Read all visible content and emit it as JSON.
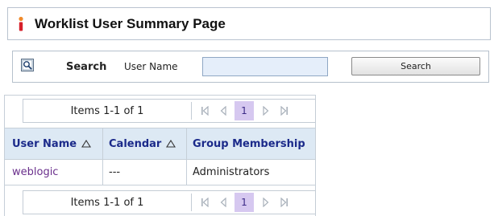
{
  "page": {
    "title": "Worklist User Summary Page",
    "title_icon": "info-icon"
  },
  "search": {
    "heading": "Search",
    "field_label": "User Name",
    "input_value": "",
    "button_label": "Search",
    "icon": "search-icon"
  },
  "pager": {
    "items_text": "Items 1-1 of 1",
    "current_page": "1",
    "icons": [
      "first-page-icon",
      "previous-page-icon",
      "next-page-icon",
      "last-page-icon"
    ]
  },
  "table": {
    "columns": [
      "User Name",
      "Calendar",
      "Group Membership"
    ],
    "rows": [
      [
        "weblogic",
        "---",
        "Administrators"
      ]
    ]
  },
  "colors": {
    "header_text": "#1b2a8a",
    "header_bg": "#dde9f4",
    "link": "#6a2f8c",
    "active_page_bg": "#d6c8f0",
    "input_bg": "#e5eefa"
  }
}
